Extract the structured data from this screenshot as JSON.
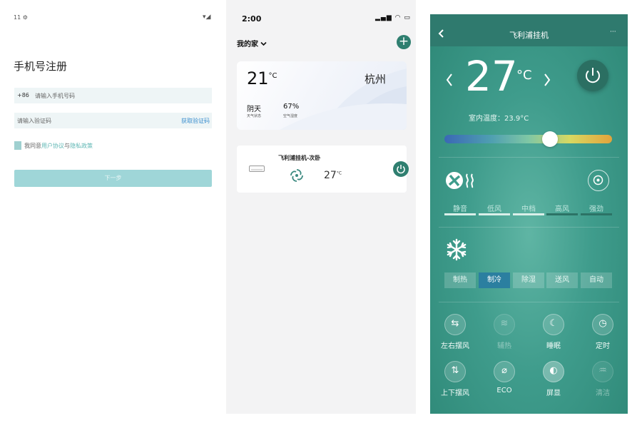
{
  "screen1": {
    "status_left": "11 ⚙",
    "status_right": "▾◢",
    "title": "手机号注册",
    "phone_prefix": "+86",
    "phone_placeholder": "请输入手机号码",
    "code_placeholder": "请输入验证码",
    "get_code": "获取验证码",
    "agree_prefix": "我同意",
    "agree_user": "用户协议",
    "agree_and": "与",
    "agree_privacy": "隐私政策",
    "next": "下一步",
    "colors": {
      "accent": "#9fd6d8",
      "link": "#5fb7b4",
      "field_bg": "#eef5f6"
    }
  },
  "screen2": {
    "time": "2:00",
    "status_icons": "▂▄▆ ◠ ▭",
    "home": "我的家",
    "home_icon": "chevron-down-icon",
    "weather": {
      "temp": "21",
      "unit": "°C",
      "city": "杭州",
      "condition": "阴天",
      "condition_label": "天气状态",
      "humidity": "67%",
      "humidity_label": "空气湿度"
    },
    "device": {
      "name": "飞利浦挂机-次卧",
      "temp": "27",
      "unit": "°C"
    },
    "colors": {
      "accent": "#2f7f70",
      "bg": "#f3f3f4"
    }
  },
  "screen3": {
    "title": "飞利浦挂机",
    "more": "···",
    "temp": "27",
    "unit": "°C",
    "indoor_label": "室内温度：",
    "indoor_value": "23.9°C",
    "slider_level": 0.63,
    "fan_speeds": [
      "静音",
      "低风",
      "中档",
      "高风",
      "强劲"
    ],
    "modes": [
      "制热",
      "制冷",
      "除湿",
      "送风",
      "自动"
    ],
    "active_mode": "制冷",
    "functions_row1": [
      {
        "label": "左右摆风",
        "icon": "swing-horizontal-icon",
        "dimmed": false
      },
      {
        "label": "辅热",
        "icon": "aux-heat-icon",
        "dimmed": true
      },
      {
        "label": "睡眠",
        "icon": "sleep-moon-icon",
        "dimmed": false
      },
      {
        "label": "定时",
        "icon": "timer-icon",
        "dimmed": false
      }
    ],
    "functions_row2": [
      {
        "label": "上下摆风",
        "icon": "swing-vertical-icon",
        "dimmed": false
      },
      {
        "label": "ECO",
        "icon": "eco-leaf-icon",
        "dimmed": false
      },
      {
        "label": "屏显",
        "icon": "display-icon",
        "dimmed": false
      },
      {
        "label": "清洁",
        "icon": "clean-icon",
        "dimmed": true
      }
    ],
    "colors": {
      "header": "#2f7a6e",
      "active_mode": "#2b7fa0",
      "bg": "#3f9c8c"
    }
  }
}
